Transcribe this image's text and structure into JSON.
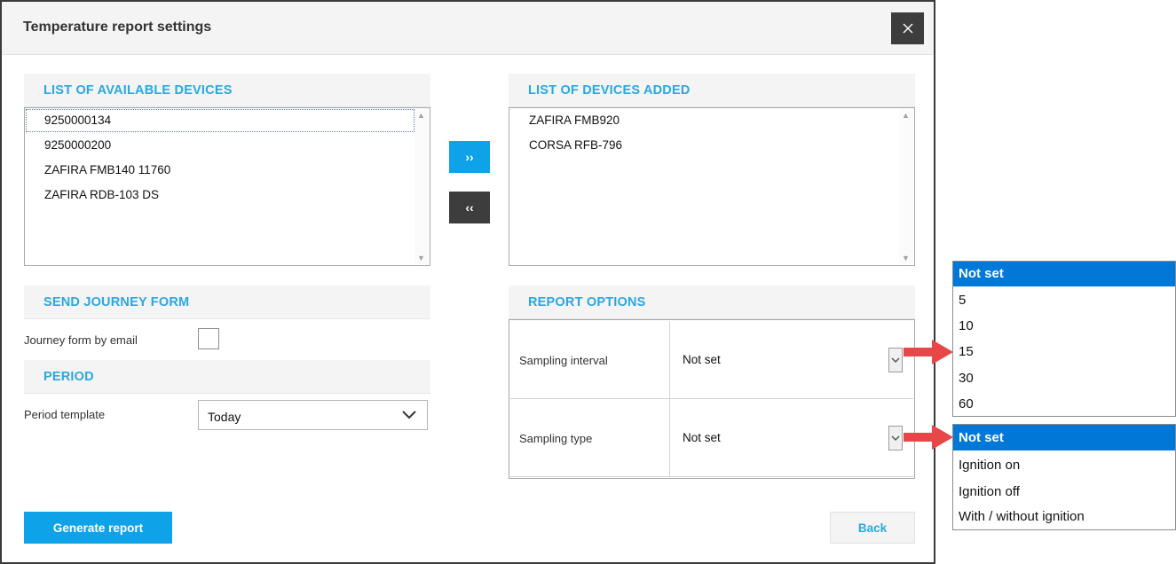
{
  "dialog": {
    "title": "Temperature report settings",
    "close_icon": "close-icon"
  },
  "available": {
    "title": "LIST OF AVAILABLE DEVICES",
    "items": [
      "9250000134",
      "9250000200",
      "ZAFIRA FMB140 11760",
      "ZAFIRA RDB-103 DS"
    ]
  },
  "added": {
    "title": "LIST OF DEVICES ADDED",
    "items": [
      "ZAFIRA FMB920",
      "CORSA RFB-796"
    ]
  },
  "move_buttons": {
    "add_label": "››",
    "remove_label": "‹‹",
    "add_color": "#0ea3e9",
    "remove_color": "#3d3d3d"
  },
  "journey": {
    "title": "SEND JOURNEY FORM",
    "label": "Journey form by email"
  },
  "period": {
    "title": "PERIOD",
    "label": "Period template",
    "value": "Today"
  },
  "report_options": {
    "title": "REPORT OPTIONS",
    "rows": [
      {
        "label": "Sampling interval",
        "value": "Not set"
      },
      {
        "label": "Sampling type",
        "value": "Not set"
      }
    ]
  },
  "footer": {
    "generate_label": "Generate report",
    "back_label": "Back"
  },
  "interval_dropdown": {
    "options": [
      "Not set",
      "5",
      "10",
      "15",
      "30",
      "60"
    ],
    "selected": "Not set"
  },
  "type_dropdown": {
    "options": [
      "Not set",
      "Ignition on",
      "Ignition off",
      "With / without ignition"
    ],
    "selected": "Not set"
  },
  "colors": {
    "accent": "#29a8e0",
    "primary_button": "#0ea3e9",
    "dark_button": "#3d3d3d",
    "dropdown_selected": "#0078d7",
    "callout_arrow": "#e8474a"
  }
}
